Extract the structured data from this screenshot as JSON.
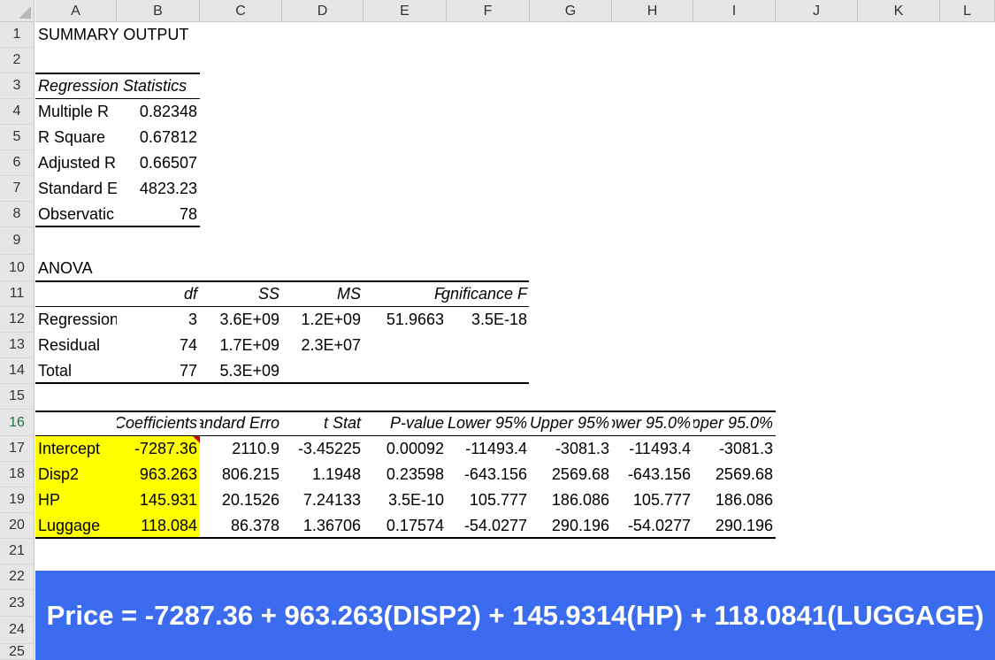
{
  "columns": [
    "A",
    "B",
    "C",
    "D",
    "E",
    "F",
    "G",
    "H",
    "I",
    "J",
    "K",
    "L"
  ],
  "rows": [
    "1",
    "2",
    "3",
    "4",
    "5",
    "6",
    "7",
    "8",
    "9",
    "10",
    "11",
    "12",
    "13",
    "14",
    "15",
    "16",
    "17",
    "18",
    "19",
    "20",
    "21",
    "22",
    "23",
    "24",
    "25"
  ],
  "summary_title": "SUMMARY OUTPUT",
  "regression_statistics": {
    "header": "Regression Statistics",
    "labels": [
      "Multiple R",
      "R Square",
      "Adjusted R",
      "Standard E",
      "Observatic"
    ],
    "values": [
      "0.82348",
      "0.67812",
      "0.66507",
      "4823.23",
      "78"
    ]
  },
  "anova": {
    "title": "ANOVA",
    "headers": [
      "df",
      "SS",
      "MS",
      "F",
      "gnificance F"
    ],
    "rows": [
      {
        "label": "Regression",
        "df": "3",
        "ss": "3.6E+09",
        "ms": "1.2E+09",
        "f": "51.9663",
        "sig": "3.5E-18"
      },
      {
        "label": "Residual",
        "df": "74",
        "ss": "1.7E+09",
        "ms": "2.3E+07",
        "f": "",
        "sig": ""
      },
      {
        "label": "Total",
        "df": "77",
        "ss": "5.3E+09",
        "ms": "",
        "f": "",
        "sig": ""
      }
    ]
  },
  "coefficients": {
    "headers": [
      "Coefficients",
      "andard Erro",
      "t Stat",
      "P-value",
      "Lower 95%",
      "Upper 95%",
      "ower 95.0%",
      "pper 95.0%"
    ],
    "rows": [
      {
        "label": "Intercept",
        "values": [
          "-7287.36",
          "2110.9",
          "-3.45225",
          "0.00092",
          "-11493.4",
          "-3081.3",
          "-11493.4",
          "-3081.3"
        ]
      },
      {
        "label": "Disp2",
        "values": [
          "963.263",
          "806.215",
          "1.1948",
          "0.23598",
          "-643.156",
          "2569.68",
          "-643.156",
          "2569.68"
        ]
      },
      {
        "label": "HP",
        "values": [
          "145.931",
          "20.1526",
          "7.24133",
          "3.5E-10",
          "105.777",
          "186.086",
          "105.777",
          "186.086"
        ]
      },
      {
        "label": "Luggage",
        "values": [
          "118.084",
          "86.378",
          "1.36706",
          "0.17574",
          "-54.0277",
          "290.196",
          "-54.0277",
          "290.196"
        ]
      }
    ]
  },
  "equation": "Price = -7287.36 + 963.263(DISP2) + 145.9314(HP) + 118.0841(LUGGAGE)",
  "colors": {
    "highlight": "#ffff00",
    "banner": "#3b6cf0",
    "selected_row_header": "#217346",
    "comment": "#d40000"
  }
}
